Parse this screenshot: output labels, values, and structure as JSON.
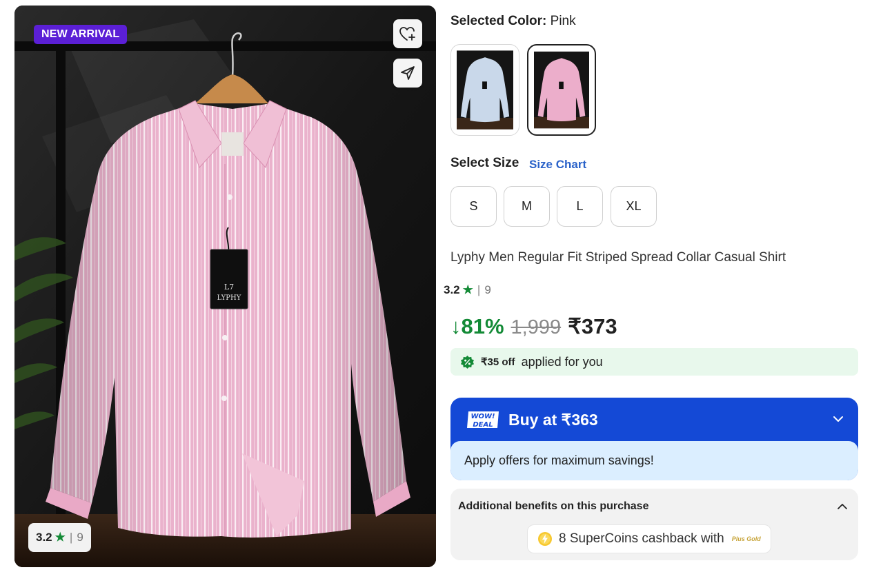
{
  "gallery": {
    "badge": "NEW ARRIVAL",
    "tag_brand": "LYPHY",
    "rating": "3.2",
    "rating_count": "9",
    "star": "★",
    "divider": "|"
  },
  "variant": {
    "selected_color_label": "Selected Color:",
    "selected_color": "Pink",
    "swatches": [
      {
        "color": "Blue",
        "hex": "#c9d8ea"
      },
      {
        "color": "Pink",
        "hex": "#ecaecb"
      }
    ],
    "select_size_label": "Select Size",
    "size_chart_link": "Size Chart",
    "sizes": [
      "S",
      "M",
      "L",
      "XL"
    ]
  },
  "product": {
    "title": "Lyphy Men Regular Fit Striped Spread Collar Casual Shirt",
    "rating": "3.2",
    "rating_count": "9",
    "discount": "↓81%",
    "mrp": "1,999",
    "price": "₹373"
  },
  "offer": {
    "amount": "₹35 off",
    "text": "applied for you"
  },
  "deal": {
    "badge_line1": "WOW!",
    "badge_line2": "DEAL",
    "buy_label": "Buy at ₹363",
    "sub_text": "Apply offers for maximum savings!"
  },
  "benefits": {
    "title": "Additional benefits on this purchase",
    "coins_text": "8 SuperCoins cashback with",
    "plus_label": "Plus Gold"
  },
  "colors": {
    "green": "#138a36",
    "blue": "#1449d6",
    "purple_badge": "#5b1fd6",
    "light_blue": "#dbeeff",
    "light_green": "#e8f8ec"
  }
}
